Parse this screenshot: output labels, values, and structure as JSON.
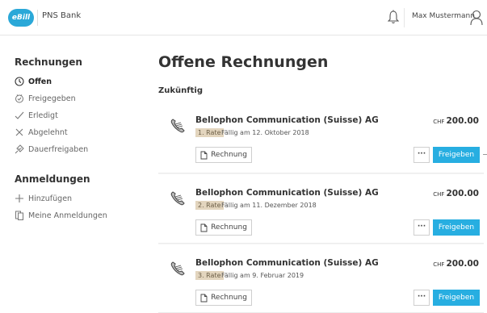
{
  "header": {
    "logo_text": "eBill",
    "bank_name": "PNS Bank",
    "user_name": "Max Mustermann",
    "icons": [
      "bell-icon",
      "user-icon"
    ]
  },
  "sidebar": {
    "invoices_heading": "Rechnungen",
    "invoice_items": [
      {
        "label": "Offen",
        "icon": "clock-icon",
        "active": true
      },
      {
        "label": "Freigegeben",
        "icon": "approved-icon",
        "active": false
      },
      {
        "label": "Erledigt",
        "icon": "check-icon",
        "active": false
      },
      {
        "label": "Abgelehnt",
        "icon": "x-icon",
        "active": false
      },
      {
        "label": "Dauerfreigaben",
        "icon": "standing-approval-icon",
        "active": false
      }
    ],
    "registrations_heading": "Anmeldungen",
    "registration_items": [
      {
        "label": "Hinzufügen",
        "icon": "plus-icon"
      },
      {
        "label": "Meine Anmeldungen",
        "icon": "documents-icon"
      }
    ]
  },
  "main": {
    "title": "Offene Rechnungen",
    "section_label": "Zukünftig",
    "bills": [
      {
        "company": "Bellophon Communication (Suisse) AG",
        "rate": "1. Rate",
        "due": "Fällig am 12. Oktober 2018",
        "currency": "CHF",
        "amount": "200.00",
        "invoice_button": "Rechnung",
        "more_button": "···",
        "approve_button": "Freigeben"
      },
      {
        "company": "Bellophon Communication (Suisse) AG",
        "rate": "2. Rate",
        "due": "Fällig am 11. Dezember 2018",
        "currency": "CHF",
        "amount": "200.00",
        "invoice_button": "Rechnung",
        "more_button": "···",
        "approve_button": "Freigeben"
      },
      {
        "company": "Bellophon Communication (Suisse) AG",
        "rate": "3. Rate",
        "due": "Fällig am 9. Februar 2019",
        "currency": "CHF",
        "amount": "200.00",
        "invoice_button": "Rechnung",
        "more_button": "···",
        "approve_button": "Freigeben"
      }
    ]
  },
  "colors": {
    "accent": "#27aee1",
    "rate_badge": "#e3d5be"
  }
}
